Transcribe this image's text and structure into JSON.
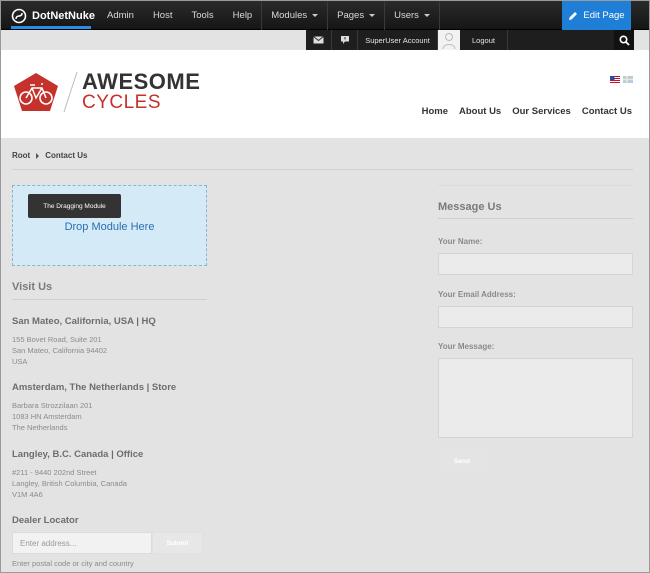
{
  "control_bar": {
    "logo_text": "DotNetNuke",
    "menu": [
      {
        "label": "Admin",
        "dropdown": false
      },
      {
        "label": "Host",
        "dropdown": false
      },
      {
        "label": "Tools",
        "dropdown": false
      },
      {
        "label": "Help",
        "dropdown": false
      },
      {
        "label": "Modules",
        "dropdown": true
      },
      {
        "label": "Pages",
        "dropdown": true
      },
      {
        "label": "Users",
        "dropdown": true
      }
    ],
    "edit_page_label": "Edit Page",
    "accent_color": "#1f7fd6"
  },
  "user_bar": {
    "mail_icon": "envelope-icon",
    "notify_icon": "speech-bubble-icon",
    "account_label": "SuperUser Account",
    "logout_label": "Logout",
    "search_icon": "search-icon"
  },
  "header": {
    "brand_line1": "AWESOME",
    "brand_line2": "CYCLES",
    "brand_color": "#c5312b",
    "languages": [
      "us-flag-icon",
      "se-flag-icon"
    ],
    "nav": [
      "Home",
      "About Us",
      "Our Services",
      "Contact Us"
    ]
  },
  "breadcrumb": {
    "root": "Root",
    "current": "Contact Us"
  },
  "drop_zone": {
    "dragging_module_label": "The Dragging Module",
    "drop_label": "Drop Module Here"
  },
  "visit": {
    "heading": "Visit Us",
    "locations": [
      {
        "name": "San Mateo, California, USA | HQ",
        "lines": [
          "155 Bovet Road, Suite 201",
          "San Mateo, California 94402",
          "USA"
        ]
      },
      {
        "name": "Amsterdam, The Netherlands | Store",
        "lines": [
          "Barbara Strozzilaan 201",
          "1083 HN Amsterdam",
          "The Netherlands"
        ]
      },
      {
        "name": "Langley, B.C. Canada | Office",
        "lines": [
          "#211 - 9440 202nd Street",
          "Langley, British Columbia, Canada",
          "V1M 4A6"
        ]
      }
    ]
  },
  "dealer": {
    "heading": "Dealer Locator",
    "placeholder": "Enter address...",
    "submit_label": "Submit",
    "hint": "Enter postal code or city and country"
  },
  "message": {
    "heading": "Message Us",
    "name_label": "Your Name:",
    "email_label": "Your Email Address:",
    "message_label": "Your Message:",
    "send_label": "Send"
  }
}
